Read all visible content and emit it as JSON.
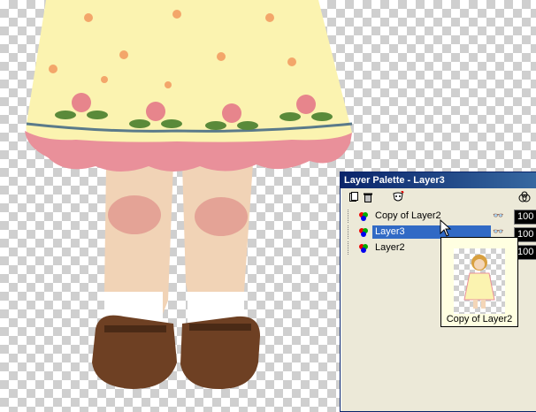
{
  "palette": {
    "title": "Layer Palette - Layer3",
    "layers": [
      {
        "name": "Copy of Layer2",
        "opacity": "100",
        "visible_icon": "glasses-icon",
        "selected": false
      },
      {
        "name": "Layer3",
        "opacity": "100",
        "visible_icon": "glasses-icon",
        "selected": true
      },
      {
        "name": "Layer2",
        "opacity": "100",
        "visible_icon": "",
        "selected": false
      }
    ],
    "toolbar_icons": [
      "new-layer-icon",
      "delete-layer-icon",
      "mask-icon",
      "opacity-icon"
    ]
  },
  "tooltip": {
    "caption": "Copy of Layer2"
  },
  "colors": {
    "dress": "#fbf3b0",
    "hem": "#e9909a",
    "skin": "#f2d2b2",
    "shoes": "#6e4023",
    "selection": "#316ac5",
    "titlebar": "#0a246a"
  }
}
